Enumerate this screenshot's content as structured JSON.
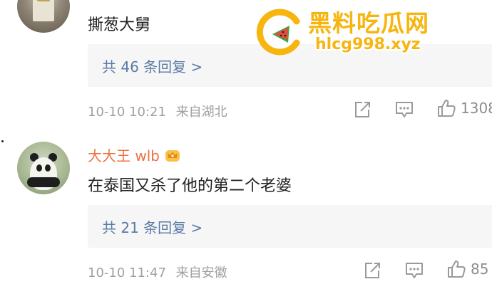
{
  "comments": [
    {
      "text": "撕葱大舅",
      "replies_label": "共 46 条回复 >",
      "timestamp": "10-10 10:21",
      "location": "来自湖北",
      "like_count": "1308"
    },
    {
      "username": "大大王 wlb",
      "text": "在泰国又杀了他的第二个老婆",
      "replies_label": "共 21 条回复 >",
      "timestamp": "10-10 11:47",
      "location": "来自安徽",
      "like_count": "85"
    }
  ],
  "watermark": {
    "title": "黑料吃瓜网",
    "url": "hlcg998.xyz"
  },
  "colors": {
    "username": "#eb7340",
    "reply_link": "#5b7ba6",
    "meta": "#a0a0a0",
    "watermark": "#f6b50f"
  },
  "icons": [
    "share-icon",
    "comment-icon",
    "like-icon",
    "vip-crown-icon",
    "watermelon-logo-icon"
  ]
}
